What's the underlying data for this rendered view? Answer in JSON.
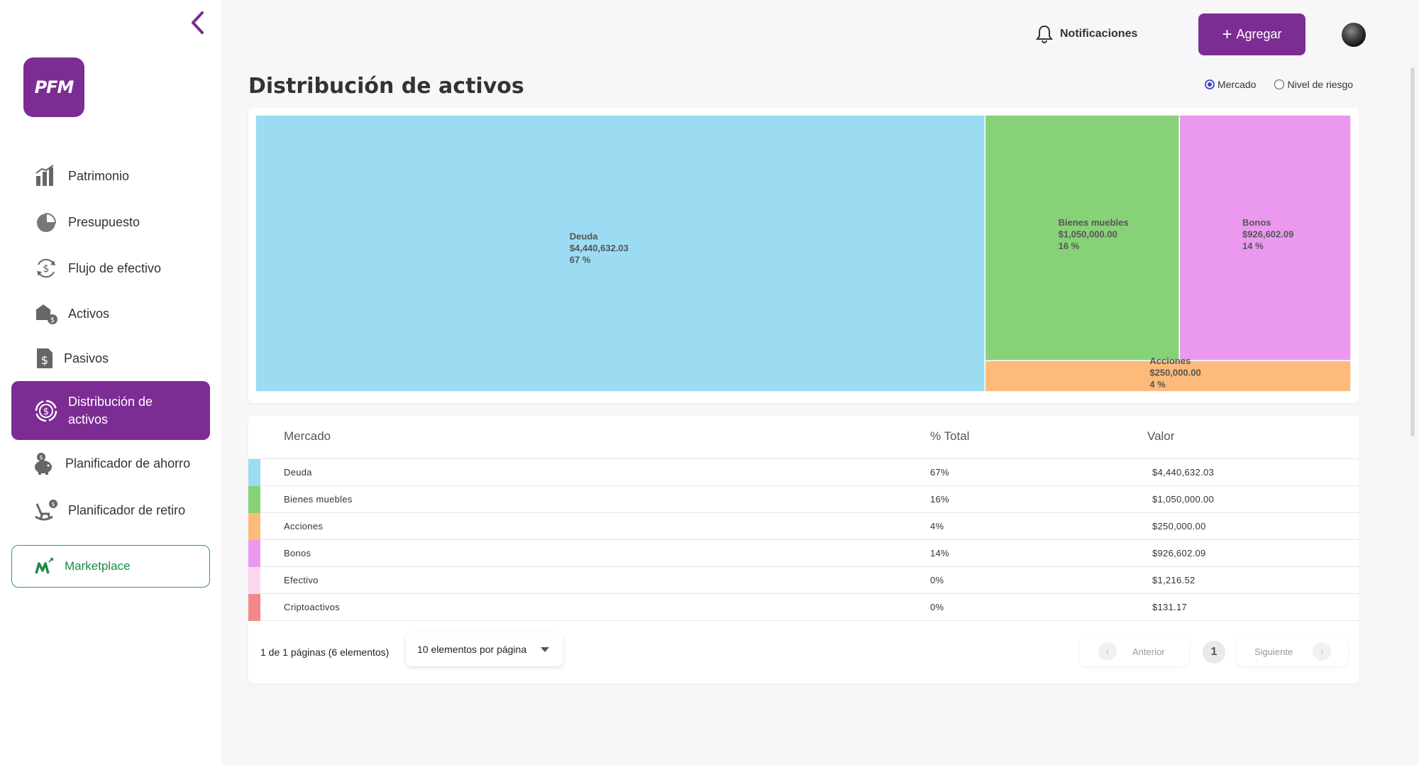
{
  "app": {
    "logo_text": "PFM"
  },
  "sidebar": {
    "items": [
      {
        "label": "Patrimonio",
        "icon": "bar-chart-icon"
      },
      {
        "label": "Presupuesto",
        "icon": "pie-chart-icon"
      },
      {
        "label": "Flujo de efectivo",
        "icon": "cash-flow-icon"
      },
      {
        "label": "Activos",
        "icon": "assets-icon"
      },
      {
        "label": "Pasivos",
        "icon": "liabilities-icon"
      },
      {
        "label": "Distribución de activos",
        "icon": "asset-distribution-icon",
        "active": true
      },
      {
        "label": "Planificador de ahorro",
        "icon": "piggy-bank-icon"
      },
      {
        "label": "Planificador de retiro",
        "icon": "rocking-chair-icon"
      }
    ],
    "marketplace_label": "Marketplace"
  },
  "header": {
    "notifications_label": "Notificaciones",
    "add_label": "Agregar"
  },
  "page": {
    "title": "Distribución de activos",
    "view_options": [
      {
        "label": "Mercado",
        "checked": true
      },
      {
        "label": "Nivel de riesgo",
        "checked": false
      }
    ]
  },
  "colors": {
    "accent": "#7b2d93",
    "marketplace_green": "#1c8a4a"
  },
  "chart_data": {
    "type": "treemap",
    "items": [
      {
        "name": "Deuda",
        "value": 4440632.03,
        "value_label": "$4,440,632.03",
        "percent_label": "67 %",
        "color": "#9bdcf3"
      },
      {
        "name": "Bienes muebles",
        "value": 1050000.0,
        "value_label": "$1,050,000.00",
        "percent_label": "16 %",
        "color": "#87d177"
      },
      {
        "name": "Bonos",
        "value": 926602.09,
        "value_label": "$926,602.09",
        "percent_label": "14 %",
        "color": "#ea99ef"
      },
      {
        "name": "Acciones",
        "value": 250000.0,
        "value_label": "$250,000.00",
        "percent_label": "4 %",
        "color": "#fdba7a"
      }
    ]
  },
  "table": {
    "headers": [
      "Mercado",
      "% Total",
      "Valor"
    ],
    "rows": [
      {
        "name": "Deuda",
        "percent": "67%",
        "value": "$4,440,632.03",
        "color": "#9bdcf3"
      },
      {
        "name": "Bienes muebles",
        "percent": "16%",
        "value": "$1,050,000.00",
        "color": "#87d177"
      },
      {
        "name": "Acciones",
        "percent": "4%",
        "value": "$250,000.00",
        "color": "#fdba7a"
      },
      {
        "name": "Bonos",
        "percent": "14%",
        "value": "$926,602.09",
        "color": "#ea99ef"
      },
      {
        "name": "Efectivo",
        "percent": "0%",
        "value": "$1,216.52",
        "color": "#fdd7ee"
      },
      {
        "name": "Criptoactivos",
        "percent": "0%",
        "value": "$131.17",
        "color": "#f3888b"
      }
    ]
  },
  "pagination": {
    "info": "1 de 1 páginas (6 elementos)",
    "per_page": "10 elementos por página",
    "prev_label": "Anterior",
    "next_label": "Siguiente",
    "current_page": "1"
  }
}
